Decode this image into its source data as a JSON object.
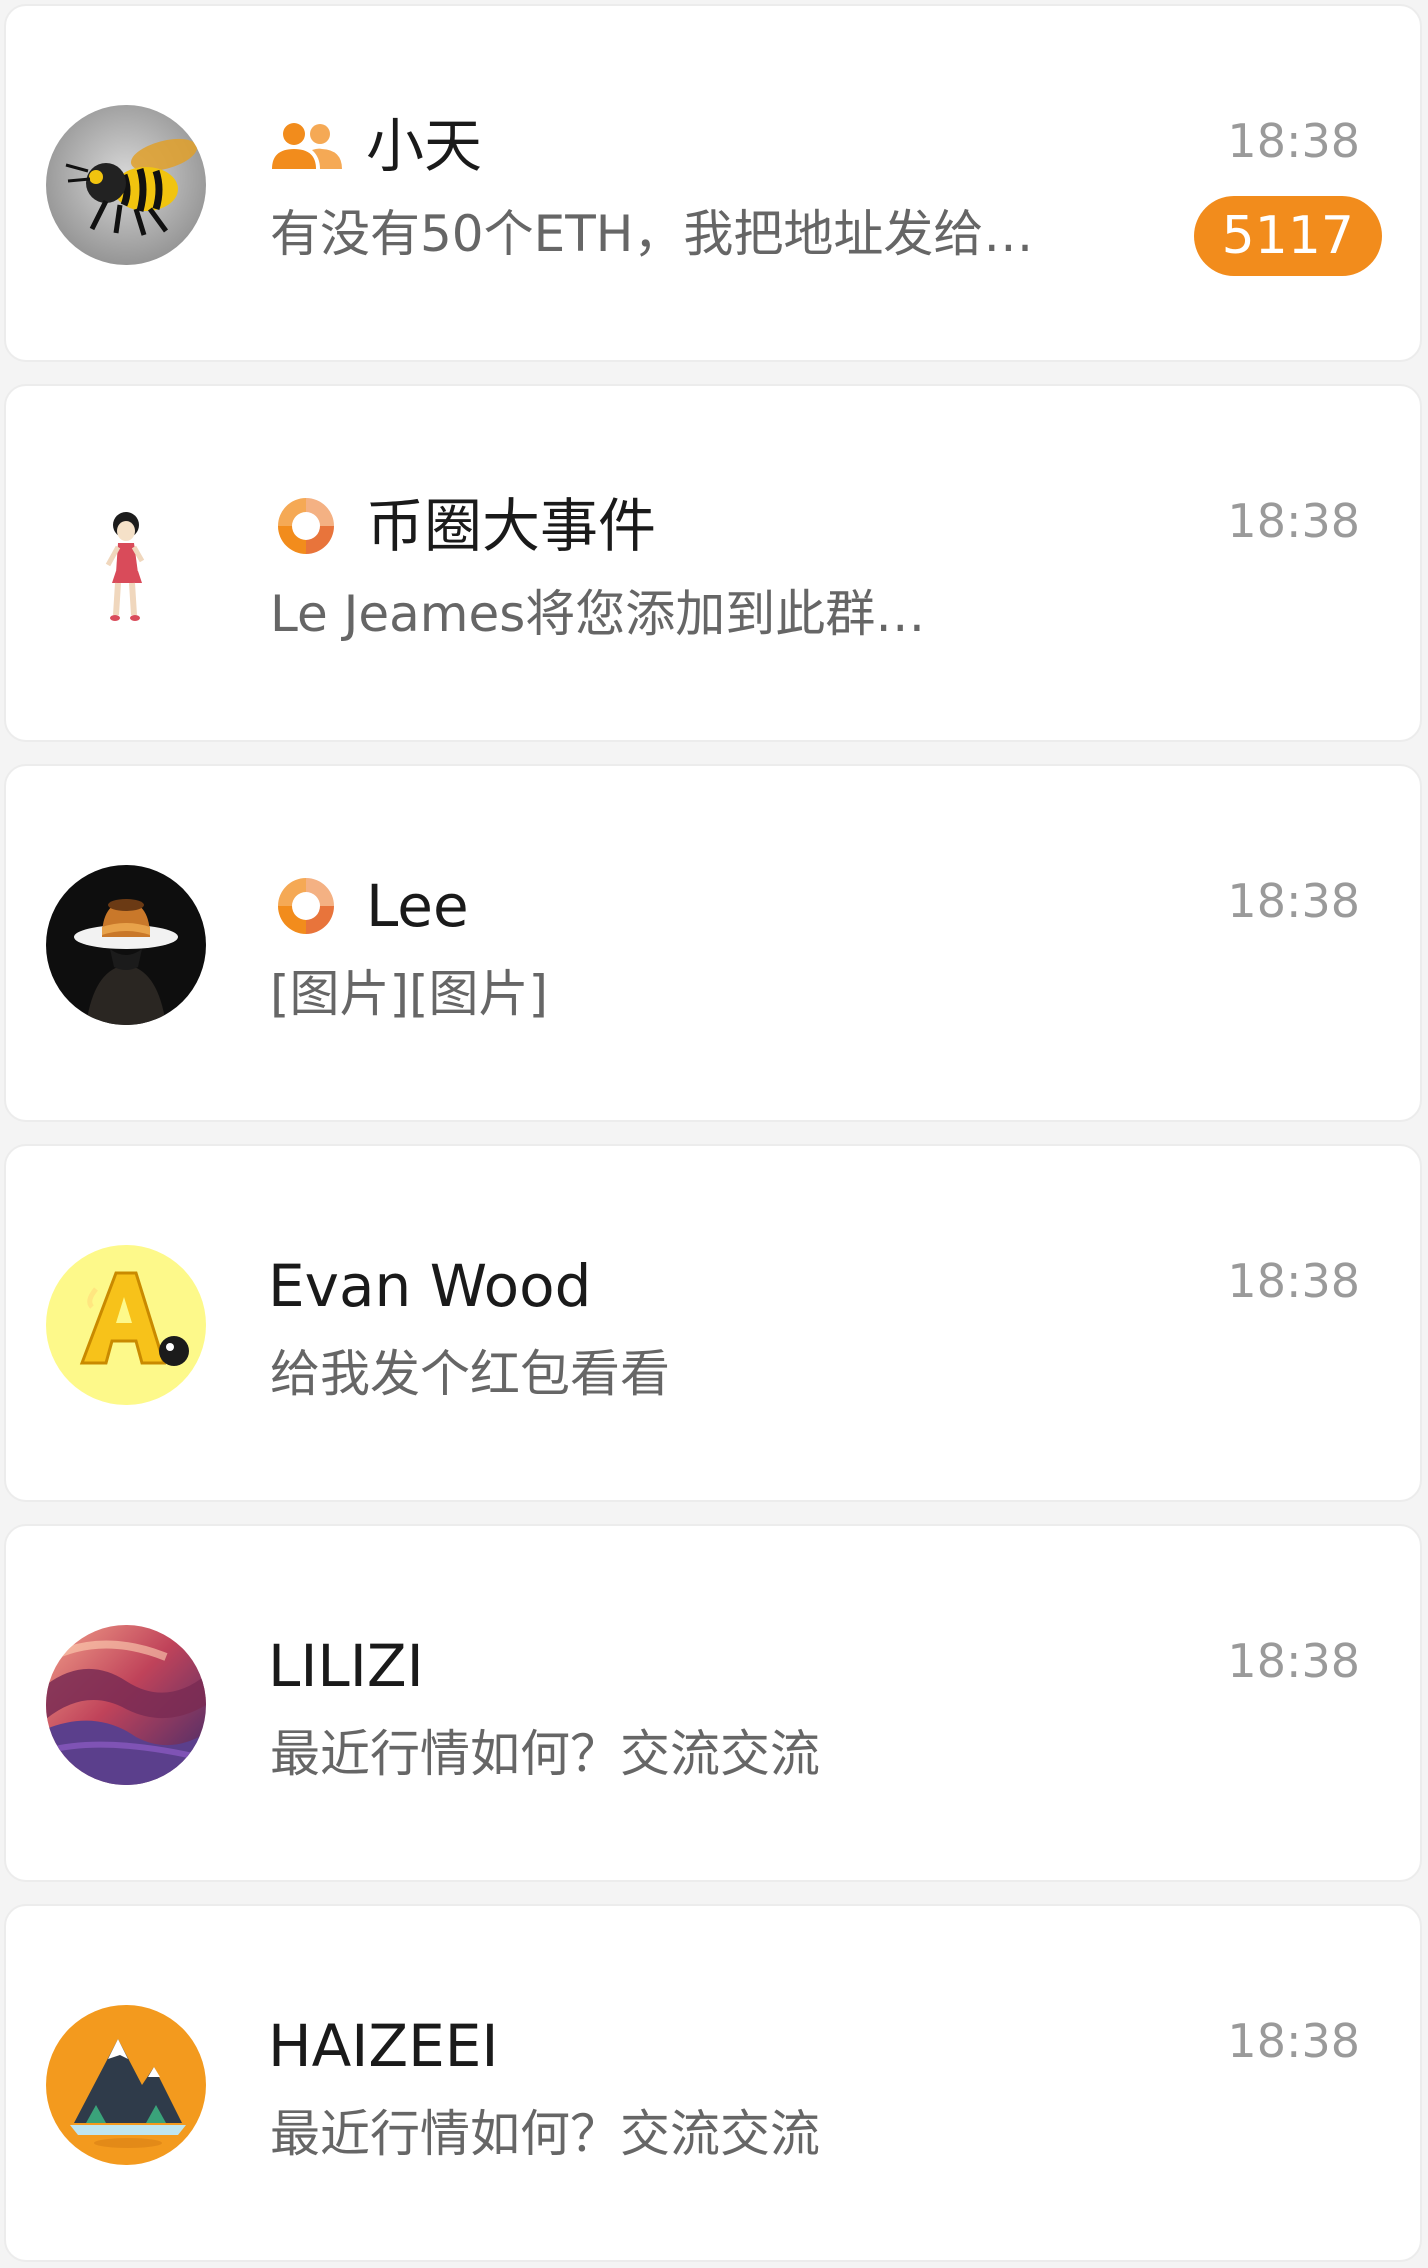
{
  "colors": {
    "accent": "#f28c1c",
    "background": "#f4f4f4",
    "card": "#ffffff",
    "name_text": "#1a1a1a",
    "preview_text": "#666666",
    "time_text": "#9a9a9a"
  },
  "chats": [
    {
      "type_icon": "group-icon",
      "avatar": "bee-avatar",
      "name": "小天",
      "preview": "有没有50个ETH，我把地址发给…",
      "time": "18:38",
      "unread": "5117"
    },
    {
      "type_icon": "channel-icon",
      "avatar": "cartoon-girl-avatar",
      "name": "币圈大事件",
      "preview": "Le Jeames将您添加到此群…",
      "time": "18:38"
    },
    {
      "type_icon": "channel-icon",
      "avatar": "hat-man-avatar",
      "name": "Lee",
      "preview": "[图片][图片]",
      "time": "18:38"
    },
    {
      "avatar": "letter-a-avatar",
      "name": "Evan Wood",
      "preview": "给我发个红包看看",
      "time": "18:38"
    },
    {
      "avatar": "canyon-avatar",
      "name": "LILIZI",
      "preview": "最近行情如何？交流交流",
      "time": "18:38"
    },
    {
      "avatar": "mountain-avatar",
      "name": "HAIZEEI",
      "preview": "最近行情如何？交流交流",
      "time": "18:38"
    }
  ]
}
